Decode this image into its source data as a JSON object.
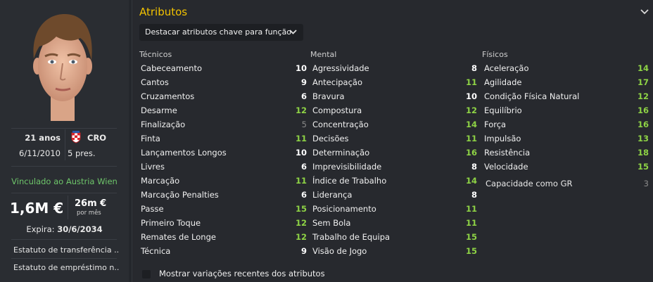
{
  "player": {
    "age": "21 anos",
    "nation": "CRO",
    "dob": "6/11/2010",
    "caps": "5 pres.",
    "club_status": "Vinculado ao Austria Wien",
    "value": "1,6M €",
    "wage": "26m €",
    "wage_period": "por mês",
    "expiry_label": "Expira:",
    "expiry_date": "30/6/2034",
    "transfer_status": "Estatuto de transferência ...",
    "loan_status": "Estatuto de empréstimo n..."
  },
  "panel": {
    "title": "Atributos",
    "highlight_dropdown": "Destacar atributos chave para função",
    "toggle_label": "Mostrar variações recentes dos atributos"
  },
  "columns": [
    {
      "header": "Técnicos",
      "items": [
        {
          "label": "Cabeceamento",
          "value": "10",
          "color": "#ffffff"
        },
        {
          "label": "Cantos",
          "value": "9",
          "color": "#ffffff"
        },
        {
          "label": "Cruzamentos",
          "value": "6",
          "color": "#ffffff"
        },
        {
          "label": "Desarme",
          "value": "12",
          "color": "#8ed345"
        },
        {
          "label": "Finalização",
          "value": "5",
          "color": "#8a8a8a"
        },
        {
          "label": "Finta",
          "value": "11",
          "color": "#8ed345"
        },
        {
          "label": "Lançamentos Longos",
          "value": "10",
          "color": "#ffffff"
        },
        {
          "label": "Livres",
          "value": "6",
          "color": "#ffffff"
        },
        {
          "label": "Marcação",
          "value": "11",
          "color": "#8ed345"
        },
        {
          "label": "Marcação Penalties",
          "value": "6",
          "color": "#ffffff"
        },
        {
          "label": "Passe",
          "value": "15",
          "color": "#8ed345"
        },
        {
          "label": "Primeiro Toque",
          "value": "12",
          "color": "#8ed345"
        },
        {
          "label": "Remates de Longe",
          "value": "12",
          "color": "#8ed345"
        },
        {
          "label": "Técnica",
          "value": "9",
          "color": "#ffffff"
        }
      ]
    },
    {
      "header": "Mental",
      "items": [
        {
          "label": "Agressividade",
          "value": "8",
          "color": "#ffffff"
        },
        {
          "label": "Antecipação",
          "value": "11",
          "color": "#8ed345"
        },
        {
          "label": "Bravura",
          "value": "10",
          "color": "#ffffff"
        },
        {
          "label": "Compostura",
          "value": "12",
          "color": "#8ed345"
        },
        {
          "label": "Concentração",
          "value": "14",
          "color": "#8ed345"
        },
        {
          "label": "Decisões",
          "value": "11",
          "color": "#8ed345"
        },
        {
          "label": "Determinação",
          "value": "16",
          "color": "#8ed345"
        },
        {
          "label": "Imprevisibilidade",
          "value": "8",
          "color": "#ffffff"
        },
        {
          "label": "Índice de Trabalho",
          "value": "14",
          "color": "#8ed345"
        },
        {
          "label": "Liderança",
          "value": "8",
          "color": "#ffffff"
        },
        {
          "label": "Posicionamento",
          "value": "11",
          "color": "#8ed345"
        },
        {
          "label": "Sem Bola",
          "value": "11",
          "color": "#8ed345"
        },
        {
          "label": "Trabalho de Equipa",
          "value": "15",
          "color": "#8ed345"
        },
        {
          "label": "Visão de Jogo",
          "value": "15",
          "color": "#8ed345"
        }
      ]
    },
    {
      "header": "Físicos",
      "items": [
        {
          "label": "Aceleração",
          "value": "14",
          "color": "#8ed345"
        },
        {
          "label": "Agilidade",
          "value": "17",
          "color": "#8ed345"
        },
        {
          "label": "Condição Física Natural",
          "value": "12",
          "color": "#8ed345"
        },
        {
          "label": "Equilíbrio",
          "value": "16",
          "color": "#8ed345"
        },
        {
          "label": "Força",
          "value": "16",
          "color": "#8ed345"
        },
        {
          "label": "Impulsão",
          "value": "13",
          "color": "#8ed345"
        },
        {
          "label": "Resistência",
          "value": "18",
          "color": "#8ed345"
        },
        {
          "label": "Velocidade",
          "value": "15",
          "color": "#8ed345"
        }
      ]
    }
  ],
  "goalkeeping": {
    "label": "Capacidade como GR",
    "value": "3"
  }
}
